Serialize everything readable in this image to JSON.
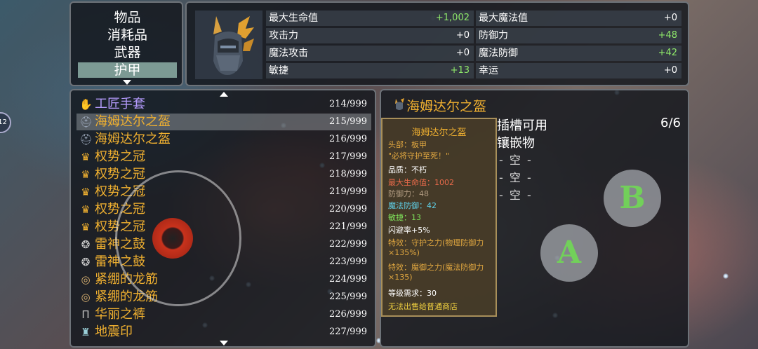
{
  "categories": {
    "items": [
      "物品",
      "消耗品",
      "武器",
      "护甲"
    ],
    "active": "护甲"
  },
  "stats": {
    "left": [
      {
        "label": "最大生命值",
        "value": "+1,002"
      },
      {
        "label": "攻击力",
        "value": "+0"
      },
      {
        "label": "魔法攻击",
        "value": "+0"
      },
      {
        "label": "敏捷",
        "value": "+13"
      }
    ],
    "right": [
      {
        "label": "最大魔法值",
        "value": "+0"
      },
      {
        "label": "防御力",
        "value": "+48"
      },
      {
        "label": "魔法防御",
        "value": "+42"
      },
      {
        "label": "幸运",
        "value": "+0"
      }
    ]
  },
  "list": {
    "items": [
      {
        "name": "工匠手套",
        "count": "214/999",
        "icon": "glove-icon"
      },
      {
        "name": "海姆达尔之盔",
        "count": "215/999",
        "icon": "helmet-icon"
      },
      {
        "name": "海姆达尔之盔",
        "count": "216/999",
        "icon": "helmet-icon"
      },
      {
        "name": "权势之冠",
        "count": "217/999",
        "icon": "crown-icon"
      },
      {
        "name": "权势之冠",
        "count": "218/999",
        "icon": "crown-icon"
      },
      {
        "name": "权势之冠",
        "count": "219/999",
        "icon": "crown-icon"
      },
      {
        "name": "权势之冠",
        "count": "220/999",
        "icon": "crown-icon"
      },
      {
        "name": "权势之冠",
        "count": "221/999",
        "icon": "crown-icon"
      },
      {
        "name": "雷神之鼓",
        "count": "222/999",
        "icon": "drum-icon"
      },
      {
        "name": "雷神之鼓",
        "count": "223/999",
        "icon": "drum-icon"
      },
      {
        "name": "紧绷的龙筋",
        "count": "224/999",
        "icon": "belt-icon"
      },
      {
        "name": "紧绷的龙筋",
        "count": "225/999",
        "icon": "belt-icon"
      },
      {
        "name": "华丽之裤",
        "count": "226/999",
        "icon": "pants-icon"
      },
      {
        "name": "地震印",
        "count": "227/999",
        "icon": "seal-icon"
      }
    ]
  },
  "detail": {
    "title": "海姆达尔之盔",
    "slots_label": "插槽可用",
    "slots_value": "6/6",
    "inlay_label": "镶嵌物",
    "empty_slots": [
      "- 空 -",
      "- 空 -",
      "- 空 -"
    ]
  },
  "tooltip": {
    "title": "海姆达尔之盔",
    "lines": [
      "头部：板甲",
      "\"必将守护至死！\"",
      "品质：不朽",
      "最大生命值：1002",
      "防御力：48",
      "魔法防御：42",
      "敏捷：13",
      "闪避率+5%",
      "特效：守护之力(物理防御力×135%)",
      "特效：魔御之力(魔法防御力×135)",
      "等级需求：30",
      "无法出售给普通商店"
    ]
  },
  "controls": {
    "b_label": "B",
    "a_label": "A",
    "edge_badge": "12"
  }
}
